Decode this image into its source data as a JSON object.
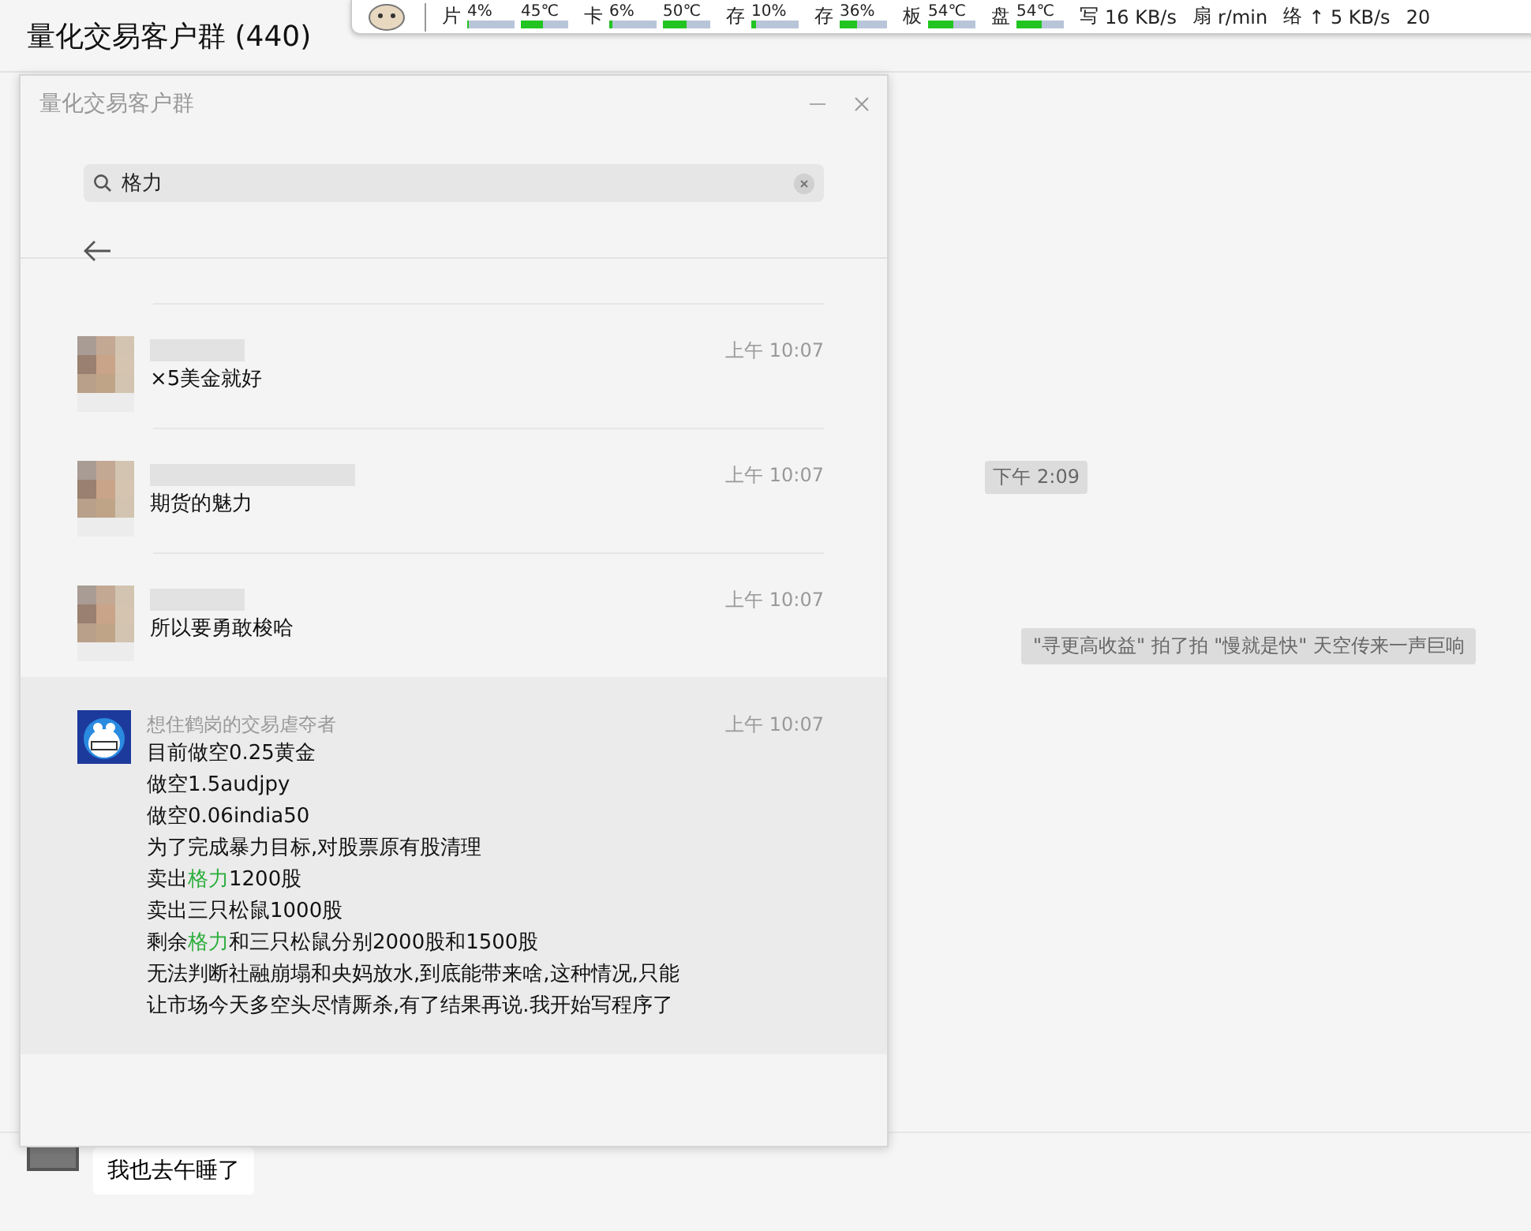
{
  "chat": {
    "title": "量化交易客户群 (440)"
  },
  "monitor": {
    "items": [
      {
        "kind": "meter",
        "label": "片",
        "readings": [
          {
            "text": "4%",
            "level": 0.04
          },
          {
            "text": "45℃",
            "level": 0.45
          }
        ]
      },
      {
        "kind": "meter",
        "label": "卡",
        "readings": [
          {
            "text": "6%",
            "level": 0.06
          },
          {
            "text": "50℃",
            "level": 0.5
          }
        ]
      },
      {
        "kind": "meter",
        "label": "存",
        "readings": [
          {
            "text": "10%",
            "level": 0.1
          }
        ]
      },
      {
        "kind": "meter",
        "label": "存",
        "readings": [
          {
            "text": "36%",
            "level": 0.36
          }
        ]
      },
      {
        "kind": "meter",
        "label": "板",
        "readings": [
          {
            "text": "54℃",
            "level": 0.54
          }
        ]
      },
      {
        "kind": "meter",
        "label": "盘",
        "readings": [
          {
            "text": "54℃",
            "level": 0.54
          }
        ]
      },
      {
        "kind": "rate",
        "label": "写",
        "text": "16 KB/s"
      },
      {
        "kind": "rate",
        "label": "扇",
        "text": "r/min"
      },
      {
        "kind": "rate",
        "label": "络",
        "text": "↑ 5 KB/s"
      },
      {
        "kind": "rate",
        "text": "20"
      }
    ]
  },
  "search_window": {
    "title": "量化交易客户群",
    "search": {
      "value": "格力"
    },
    "results": [
      {
        "kind": "pixelated",
        "time": "上午 10:07",
        "selected": false,
        "lines": [
          [
            {
              "text": "×5美金就好",
              "match": false
            }
          ]
        ]
      },
      {
        "kind": "pixelated",
        "time": "上午 10:07",
        "selected": false,
        "lines": [
          [
            {
              "text": "期货的魅力",
              "match": false
            }
          ]
        ]
      },
      {
        "kind": "pixelated",
        "time": "上午 10:07",
        "selected": false,
        "lines": [
          [
            {
              "text": "所以要勇敢梭哈",
              "match": false
            }
          ]
        ]
      },
      {
        "kind": "cartoon",
        "sender": "想住鹤岗的交易虐夺者",
        "time": "上午 10:07",
        "selected": true,
        "lines": [
          [
            {
              "text": "目前做空0.25黄金",
              "match": false
            }
          ],
          [
            {
              "text": "做空1.5audjpy",
              "match": false
            }
          ],
          [
            {
              "text": "做空0.06india50",
              "match": false
            }
          ],
          [
            {
              "text": "为了完成暴力目标,对股票原有股清理",
              "match": false
            }
          ],
          [
            {
              "text": "卖出",
              "match": false
            },
            {
              "text": "格力",
              "match": true
            },
            {
              "text": "1200股",
              "match": false
            }
          ],
          [
            {
              "text": "卖出三只松鼠1000股",
              "match": false
            }
          ],
          [
            {
              "text": "剩余",
              "match": false
            },
            {
              "text": "格力",
              "match": true
            },
            {
              "text": "和三只松鼠分别2000股和1500股",
              "match": false
            }
          ],
          [
            {
              "text": "无法判断社融崩塌和央妈放水,到底能带来啥,这种情况,只能让市场今天多空头尽情厮杀,有了结果再说.我开始写程序了",
              "match": false
            }
          ]
        ]
      }
    ]
  },
  "conversation": {
    "time_tag": "下午 2:09",
    "system_message": "\"寻更高收益\" 拍了拍 \"慢就是快\" 天空传来一声巨响",
    "last_message": "我也去午睡了"
  }
}
